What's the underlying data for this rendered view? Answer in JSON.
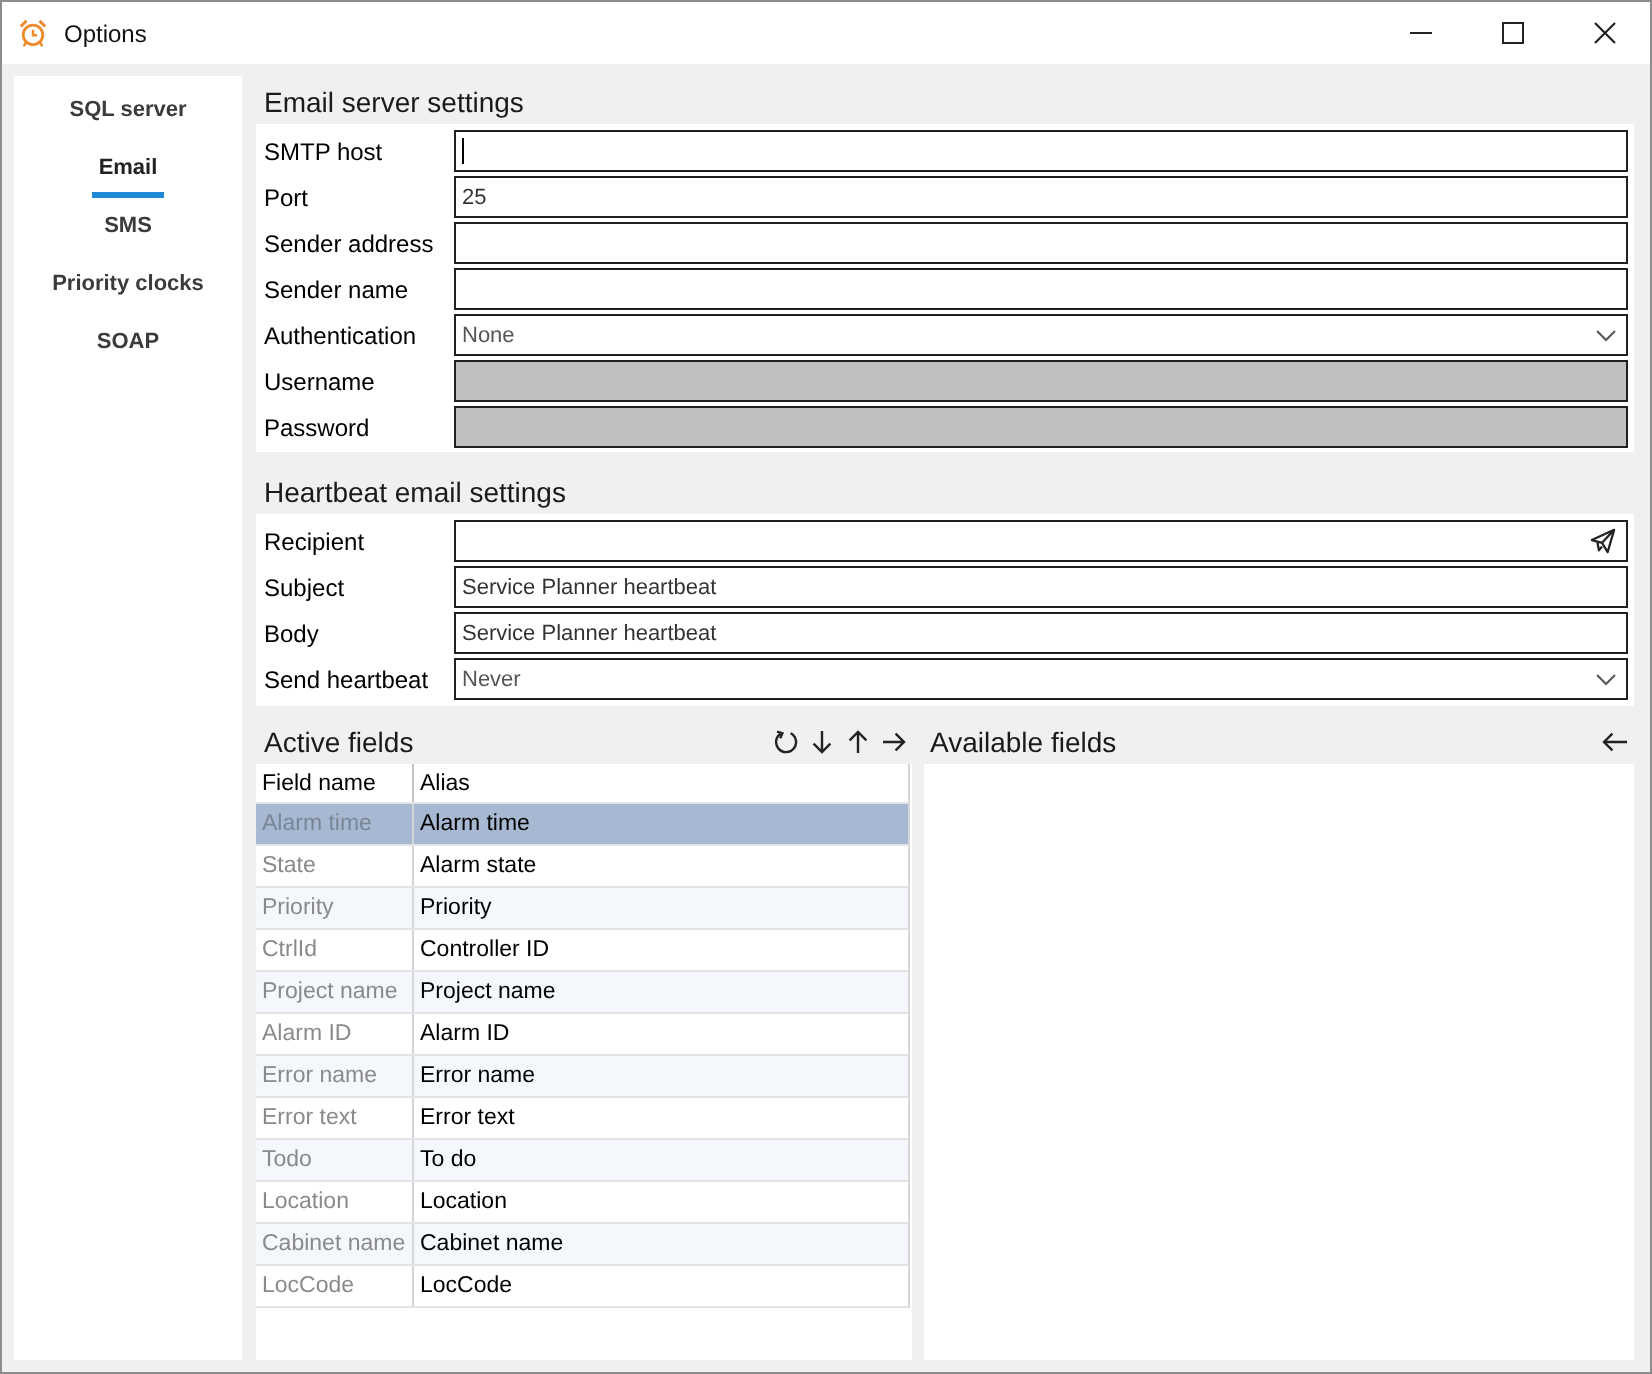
{
  "window": {
    "title": "Options"
  },
  "sidebar": {
    "items": [
      {
        "label": "SQL server",
        "selected": false
      },
      {
        "label": "Email",
        "selected": true
      },
      {
        "label": "SMS",
        "selected": false
      },
      {
        "label": "Priority clocks",
        "selected": false
      },
      {
        "label": "SOAP",
        "selected": false
      }
    ]
  },
  "email_server_settings": {
    "title": "Email server settings",
    "fields": [
      {
        "label": "SMTP host",
        "kind": "text",
        "disabled": false,
        "focused": true
      },
      {
        "label": "Port",
        "kind": "text",
        "value": "25",
        "disabled": false,
        "focused": false
      },
      {
        "label": "Sender address",
        "kind": "text",
        "disabled": false,
        "focused": false
      },
      {
        "label": "Sender name",
        "kind": "text",
        "disabled": false,
        "focused": false
      },
      {
        "label": "Authentication",
        "kind": "dropdown",
        "value": "None",
        "disabled": false,
        "focused": false
      },
      {
        "label": "Username",
        "kind": "text",
        "disabled": true,
        "focused": false
      },
      {
        "label": "Password",
        "kind": "text",
        "disabled": true,
        "focused": false
      }
    ]
  },
  "heartbeat_email_settings": {
    "title": "Heartbeat email settings",
    "fields": [
      {
        "label": "Recipient",
        "kind": "send"
      },
      {
        "label": "Subject",
        "kind": "text",
        "value": "Service Planner heartbeat"
      },
      {
        "label": "Body",
        "kind": "text",
        "value": "Service Planner heartbeat"
      },
      {
        "label": "Send heartbeat",
        "kind": "dropdown",
        "value": "Never"
      }
    ]
  },
  "active_fields": {
    "title": "Active fields",
    "table": {
      "columns": [
        "Field name",
        "Alias"
      ],
      "rows": [
        {
          "field_name": "Alarm time",
          "alias": "Alarm time",
          "selected": true
        },
        {
          "field_name": "State",
          "alias": "Alarm state",
          "selected": false
        },
        {
          "field_name": "Priority",
          "alias": "Priority",
          "selected": false
        },
        {
          "field_name": "CtrlId",
          "alias": "Controller ID",
          "selected": false
        },
        {
          "field_name": "Project name",
          "alias": "Project name",
          "selected": false
        },
        {
          "field_name": "Alarm ID",
          "alias": "Alarm ID",
          "selected": false
        },
        {
          "field_name": "Error name",
          "alias": "Error name",
          "selected": false
        },
        {
          "field_name": "Error text",
          "alias": "Error text",
          "selected": false
        },
        {
          "field_name": "Todo",
          "alias": "To do",
          "selected": false
        },
        {
          "field_name": "Location",
          "alias": "Location",
          "selected": false
        },
        {
          "field_name": "Cabinet name",
          "alias": "Cabinet name",
          "selected": false
        },
        {
          "field_name": "LocCode",
          "alias": "LocCode",
          "selected": false
        }
      ]
    }
  },
  "available_fields": {
    "title": "Available fields"
  }
}
